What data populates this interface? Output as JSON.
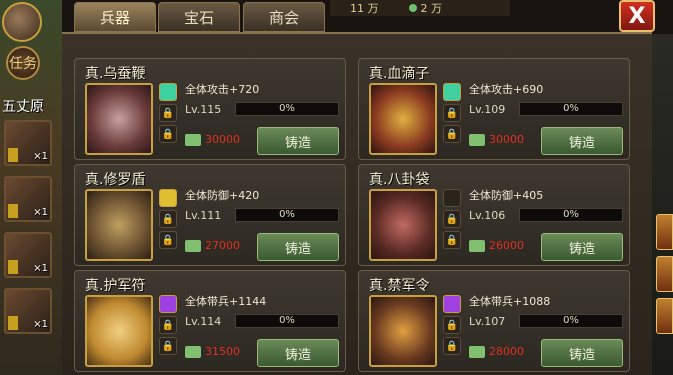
{
  "sidebar": {
    "task_label": "任务",
    "place_label": "五丈原",
    "units": [
      {
        "count": "×1"
      },
      {
        "count": "×1"
      },
      {
        "count": "×1"
      },
      {
        "count": "×1"
      }
    ]
  },
  "currency": {
    "silver": "11 万",
    "gold": "2 万"
  },
  "tabs": [
    {
      "label": "兵器",
      "active": true
    },
    {
      "label": "宝石",
      "active": false
    },
    {
      "label": "商会",
      "active": false
    }
  ],
  "close_label": "X",
  "items": [
    {
      "name": "真.乌蚕鞭",
      "stat": "全体攻击+720",
      "level": "Lv.115",
      "progress": "0%",
      "cost": "30000",
      "forge": "铸造",
      "gem": "green"
    },
    {
      "name": "真.血滴子",
      "stat": "全体攻击+690",
      "level": "Lv.109",
      "progress": "0%",
      "cost": "30000",
      "forge": "铸造",
      "gem": "green"
    },
    {
      "name": "真.修罗盾",
      "stat": "全体防御+420",
      "level": "Lv.111",
      "progress": "0%",
      "cost": "27000",
      "forge": "铸造",
      "gem": "yellow"
    },
    {
      "name": "真.八卦袋",
      "stat": "全体防御+405",
      "level": "Lv.106",
      "progress": "0%",
      "cost": "26000",
      "forge": "铸造",
      "gem": "none"
    },
    {
      "name": "真.护军符",
      "stat": "全体带兵+1144",
      "level": "Lv.114",
      "progress": "0%",
      "cost": "31500",
      "forge": "铸造",
      "gem": "purple"
    },
    {
      "name": "真.禁军令",
      "stat": "全体带兵+1088",
      "level": "Lv.107",
      "progress": "0%",
      "cost": "28000",
      "forge": "铸造",
      "gem": "purple"
    }
  ],
  "colors": {
    "gem_green": "#40d0a0",
    "gem_yellow": "#e0c030",
    "gem_purple": "#a040e0"
  }
}
